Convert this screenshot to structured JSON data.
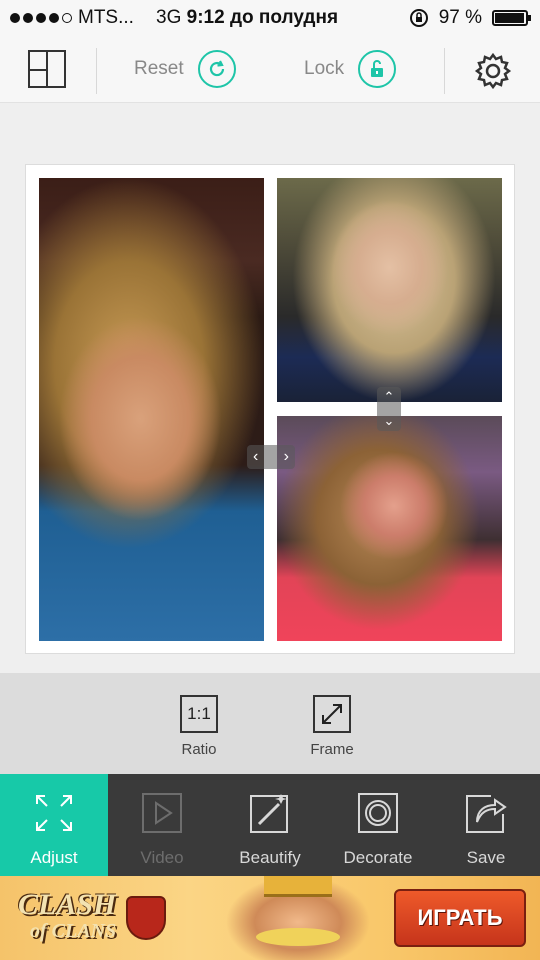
{
  "status_bar": {
    "carrier": "MTS...",
    "network": "3G",
    "time": "9:12 до полудня",
    "battery_percent": "97 %",
    "battery_level": 0.97,
    "signal_bars": 4
  },
  "toolbar": {
    "reset_label": "Reset",
    "lock_label": "Lock",
    "accent_color": "#1ec5a8"
  },
  "collage": {
    "photos": [
      "photo-left",
      "photo-top-right",
      "photo-bottom-right"
    ]
  },
  "sub_options": {
    "ratio_icon_text": "1:1",
    "ratio_label": "Ratio",
    "frame_label": "Frame"
  },
  "tabs": [
    {
      "label": "Adjust",
      "icon": "expand-arrows-icon",
      "state": "active"
    },
    {
      "label": "Video",
      "icon": "play-icon",
      "state": "disabled"
    },
    {
      "label": "Beautify",
      "icon": "magic-wand-icon",
      "state": "normal"
    },
    {
      "label": "Decorate",
      "icon": "ring-icon",
      "state": "normal"
    },
    {
      "label": "Save",
      "icon": "share-arrow-icon",
      "state": "normal"
    }
  ],
  "ad": {
    "logo_line1": "CLASH",
    "logo_line2": "of CLANS",
    "cta_label": "ИГРАТЬ"
  }
}
